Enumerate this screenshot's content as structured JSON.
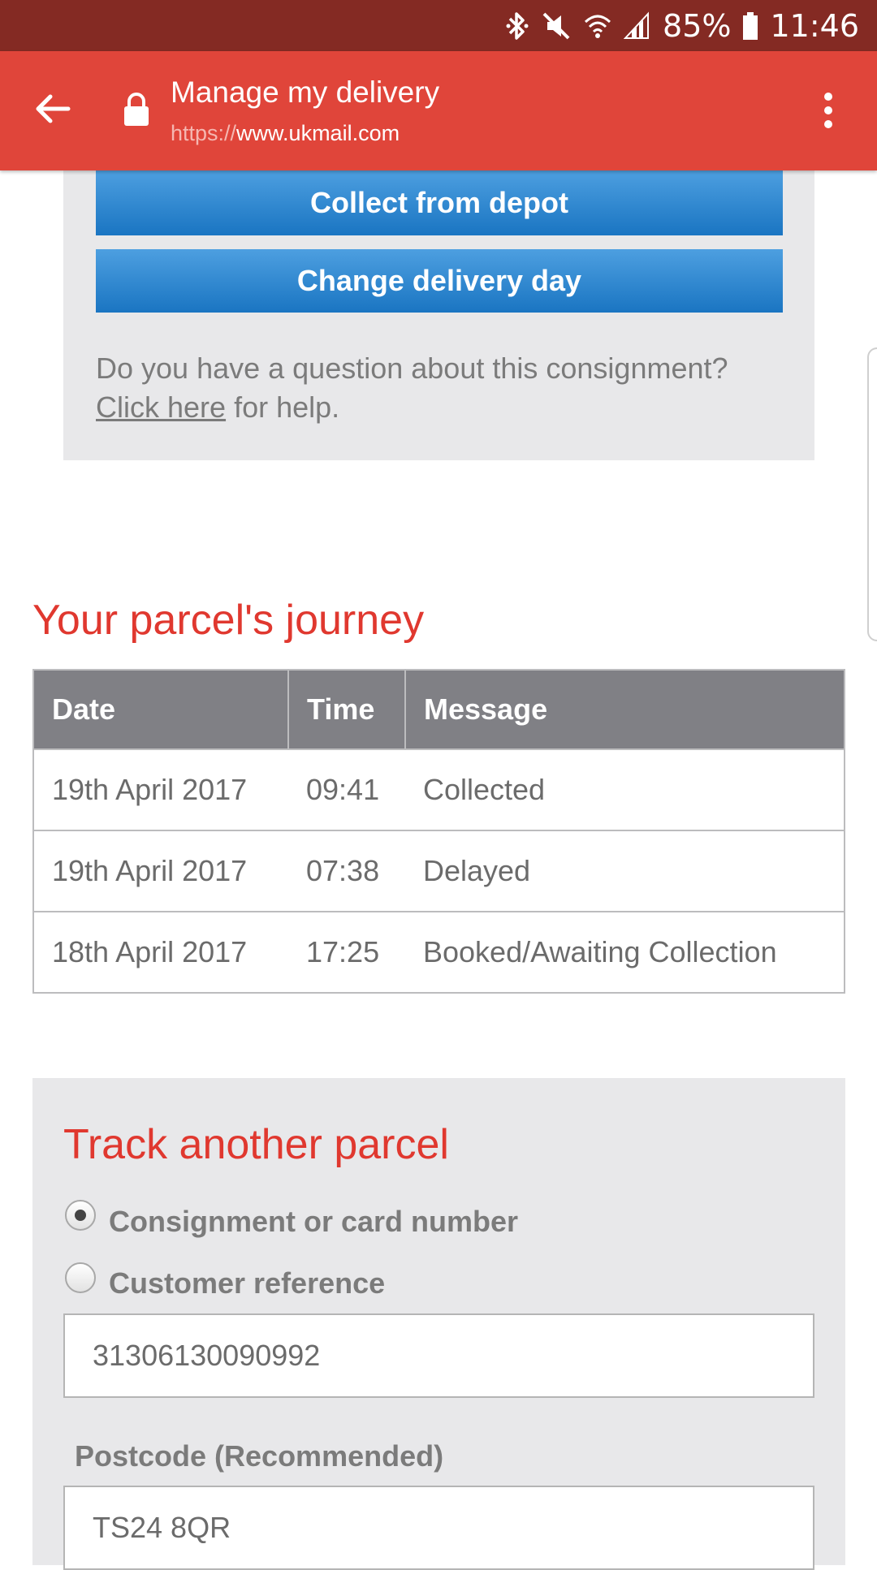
{
  "status_bar": {
    "battery": "85%",
    "time": "11:46",
    "icons": [
      "bluetooth-icon",
      "mute-icon",
      "wifi-icon",
      "signal-icon",
      "battery-icon"
    ]
  },
  "toolbar": {
    "title": "Manage my delivery",
    "url_scheme": "https://",
    "url_host": "www.ukmail.com",
    "color": "#e0453a"
  },
  "actions": {
    "collect_label": "Collect from depot",
    "change_day_label": "Change delivery day"
  },
  "help": {
    "prefix": "Do you have a question about this consignment? ",
    "link": "Click here",
    "suffix": " for help."
  },
  "journey": {
    "title": "Your parcel's journey",
    "columns": [
      "Date",
      "Time",
      "Message"
    ],
    "rows": [
      {
        "date": "19th April 2017",
        "time": "09:41",
        "message": "Collected"
      },
      {
        "date": "19th April 2017",
        "time": "07:38",
        "message": "Delayed"
      },
      {
        "date": "18th April 2017",
        "time": "17:25",
        "message": "Booked/Awaiting Collection"
      }
    ]
  },
  "track": {
    "title": "Track another parcel",
    "option_consignment": "Consignment or card number",
    "option_customer": "Customer reference",
    "selected": "consignment",
    "consignment_value": "31306130090992",
    "postcode_label": "Postcode (Recommended)",
    "postcode_value": "TS24 8QR"
  },
  "colors": {
    "status_bar": "#842a23",
    "accent_red": "#e0382f",
    "button_blue": "#1a75c2",
    "panel_grey": "#e8e8ea",
    "table_header": "#808085"
  }
}
